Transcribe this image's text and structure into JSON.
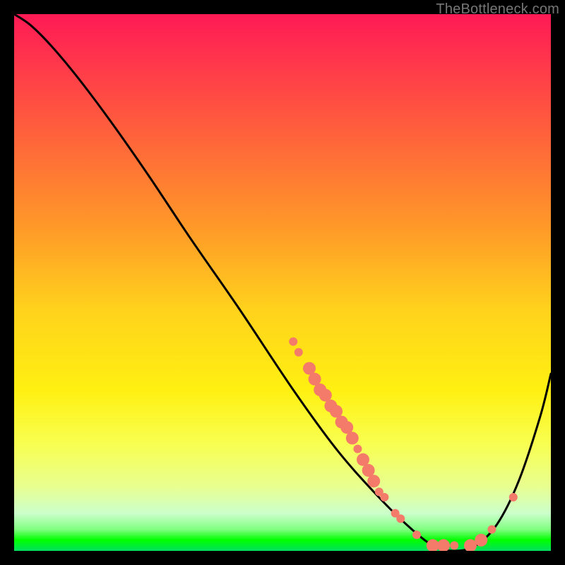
{
  "watermark": "TheBottleneck.com",
  "colors": {
    "gradient_top": "#ff1a55",
    "gradient_mid": "#ffe411",
    "gradient_bottom": "#00e060",
    "curve": "#000000",
    "marker": "#f47a6a"
  },
  "chart_data": {
    "type": "line",
    "title": "",
    "xlabel": "",
    "ylabel": "",
    "xlim": [
      0,
      100
    ],
    "ylim": [
      0,
      100
    ],
    "grid": false,
    "legend": false,
    "note": "Bottleneck-style curve. Lower y = better (minimum near x≈80). No tick labels shown in source image; values are image-space percentages.",
    "series": [
      {
        "name": "bottleneck-curve",
        "x": [
          0,
          3,
          7,
          12,
          18,
          25,
          33,
          42,
          52,
          60,
          67,
          73,
          78,
          82,
          86,
          90,
          94,
          98,
          100
        ],
        "y": [
          100,
          98,
          94,
          88,
          80,
          70,
          58,
          45,
          30,
          19,
          11,
          5,
          1,
          0,
          1,
          5,
          13,
          25,
          33
        ]
      }
    ],
    "markers": {
      "name": "highlighted-points",
      "color": "#f47a6a",
      "radius_major": 9,
      "radius_minor": 6,
      "points": [
        {
          "x": 52,
          "y": 39,
          "r": 6
        },
        {
          "x": 53,
          "y": 37,
          "r": 6
        },
        {
          "x": 55,
          "y": 34,
          "r": 9
        },
        {
          "x": 56,
          "y": 32,
          "r": 9
        },
        {
          "x": 57,
          "y": 30,
          "r": 9
        },
        {
          "x": 58,
          "y": 29,
          "r": 9
        },
        {
          "x": 59,
          "y": 27,
          "r": 9
        },
        {
          "x": 60,
          "y": 26,
          "r": 9
        },
        {
          "x": 61,
          "y": 24,
          "r": 9
        },
        {
          "x": 62,
          "y": 23,
          "r": 9
        },
        {
          "x": 63,
          "y": 21,
          "r": 9
        },
        {
          "x": 64,
          "y": 19,
          "r": 6
        },
        {
          "x": 65,
          "y": 17,
          "r": 9
        },
        {
          "x": 66,
          "y": 15,
          "r": 9
        },
        {
          "x": 67,
          "y": 13,
          "r": 9
        },
        {
          "x": 68,
          "y": 11,
          "r": 6
        },
        {
          "x": 69,
          "y": 10,
          "r": 6
        },
        {
          "x": 71,
          "y": 7,
          "r": 6
        },
        {
          "x": 72,
          "y": 6,
          "r": 6
        },
        {
          "x": 75,
          "y": 3,
          "r": 6
        },
        {
          "x": 78,
          "y": 1,
          "r": 9
        },
        {
          "x": 80,
          "y": 1,
          "r": 9
        },
        {
          "x": 82,
          "y": 1,
          "r": 6
        },
        {
          "x": 85,
          "y": 1,
          "r": 9
        },
        {
          "x": 87,
          "y": 2,
          "r": 9
        },
        {
          "x": 89,
          "y": 4,
          "r": 6
        },
        {
          "x": 93,
          "y": 10,
          "r": 6
        }
      ]
    }
  }
}
